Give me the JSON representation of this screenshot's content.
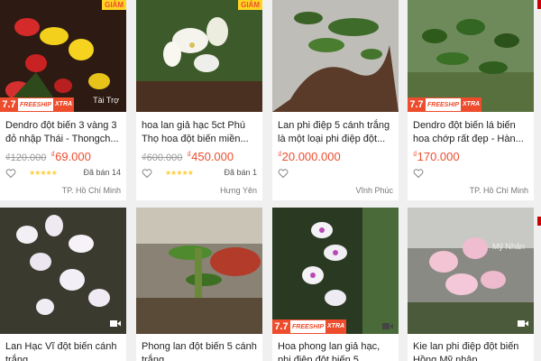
{
  "products_row1": [
    {
      "title": "Dendro đột biến 3 vàng 3 đỏ nhập Thái - Thongch...",
      "old_price": "₫120.000",
      "price": "69.000",
      "currency": "₫",
      "stars": "★★★★★",
      "sold": "Đã bán 14",
      "location": "TP. Hồ Chí Minh",
      "badge": "GIẢM",
      "sponsored": "Tài Trợ",
      "freeship": true
    },
    {
      "title": "hoa lan giả hạc 5ct Phú Thọ hoa đột biến miền...",
      "old_price": "₫600.000",
      "price": "450.000",
      "currency": "₫",
      "stars": "★★★★★",
      "sold": "Đã bán 1",
      "location": "Hưng Yên",
      "badge": "GIẢM"
    },
    {
      "title": "Lan phi điệp 5 cánh trắng là một loại phi điệp đột...",
      "price": "20.000.000",
      "currency": "₫",
      "location": "Vĩnh Phúc"
    },
    {
      "title": "Dendro đột biến lá biến hoa chớp rất đẹp - Hàn...",
      "price": "170.000",
      "currency": "₫",
      "location": "TP. Hồ Chí Minh",
      "freeship": true
    }
  ],
  "products_row2": [
    {
      "title": "Lan Hạc Vĩ đột biến cánh trắng"
    },
    {
      "title": "Phong lan đột biến 5 cánh trắng"
    },
    {
      "title": "Hoa phong lan giả hạc, phi điệp đột biến 5...",
      "freeship": true
    },
    {
      "title": "Kie lan phi điệp đột biến Hồng Mỹ nhập...",
      "watermark": "Mỹ Nhân"
    }
  ],
  "freeship_badge": {
    "num": "7.7",
    "label": "FREESHIP",
    "extra": "XTRA"
  },
  "colors": {
    "accent": "#ee4d2d",
    "star": "#ffce3d",
    "badge_yellow": "#ffd424"
  },
  "icons": {
    "heart": "heart-outline-icon",
    "video": "video-camera-icon"
  }
}
